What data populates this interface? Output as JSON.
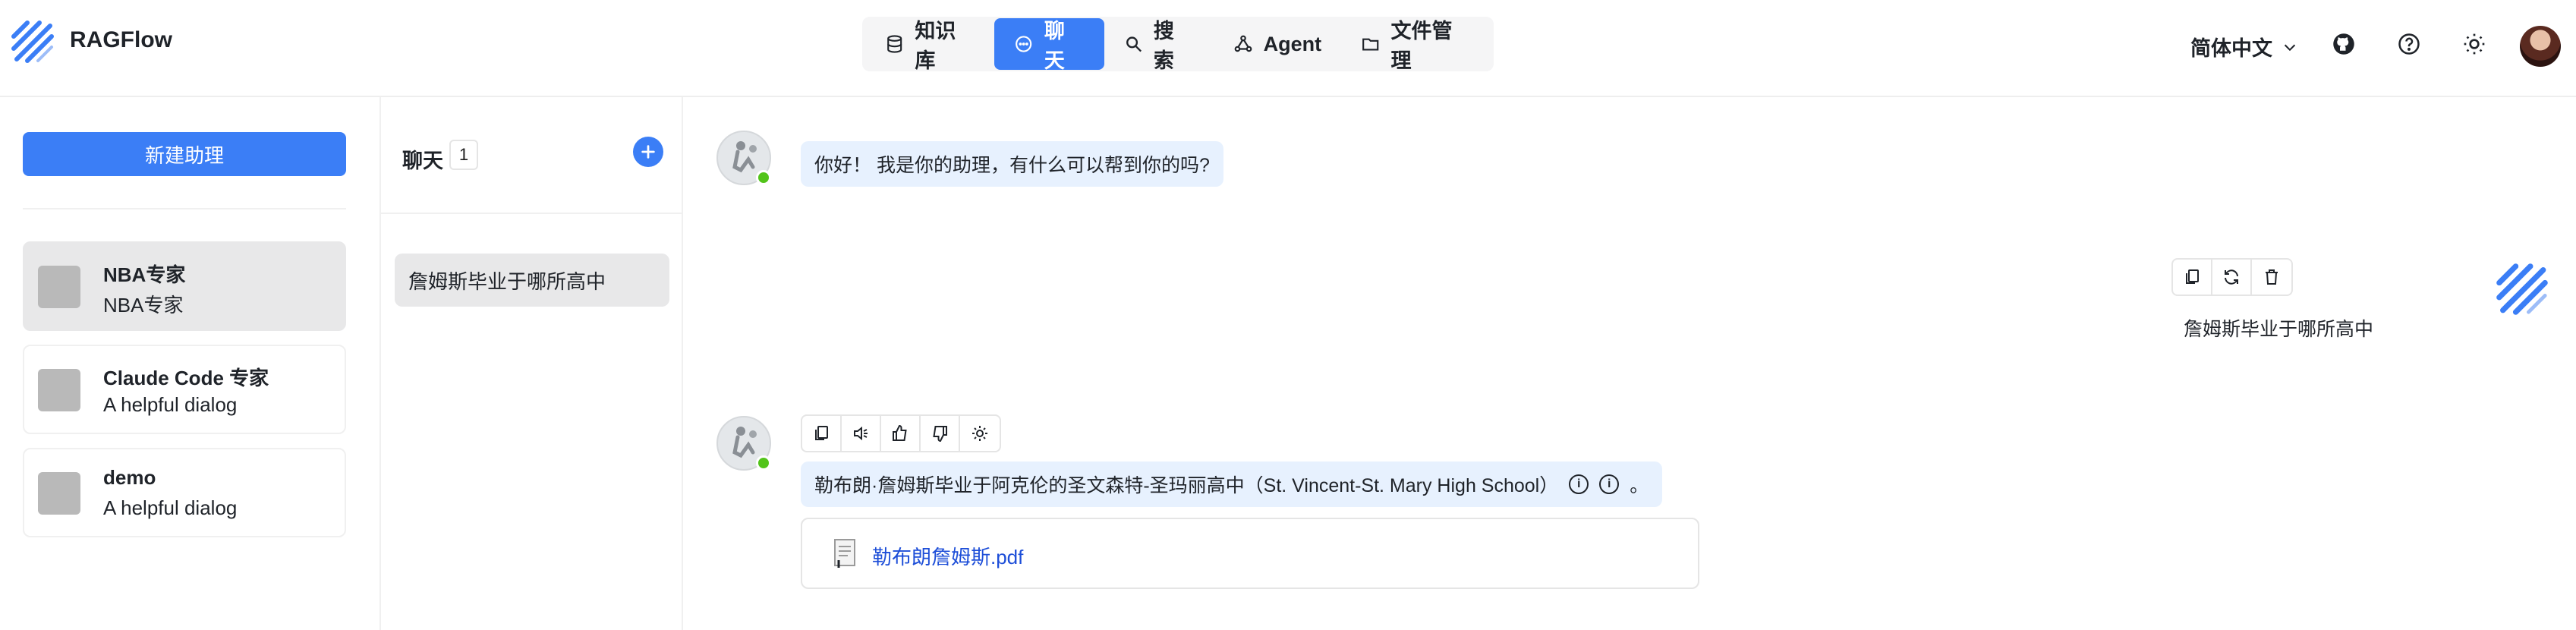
{
  "header": {
    "app_name": "RAGFlow",
    "nav": [
      {
        "label": "知识库",
        "icon": "database-icon",
        "active": false
      },
      {
        "label": "聊天",
        "icon": "chat-icon",
        "active": true
      },
      {
        "label": "搜索",
        "icon": "search-icon",
        "active": false
      },
      {
        "label": "Agent",
        "icon": "agent-icon",
        "active": false
      },
      {
        "label": "文件管理",
        "icon": "folder-icon",
        "active": false
      }
    ],
    "language": "简体中文",
    "icons": [
      "github-icon",
      "help-icon",
      "theme-sun-icon"
    ],
    "accent_color": "#3b7ef6"
  },
  "assistants": {
    "new_button": "新建助理",
    "items": [
      {
        "name": "NBA专家",
        "description": "NBA专家",
        "selected": true
      },
      {
        "name": "Claude Code 专家",
        "description": "A helpful dialog",
        "selected": false
      },
      {
        "name": "demo",
        "description": "A helpful dialog",
        "selected": false
      }
    ]
  },
  "conversations": {
    "title": "聊天",
    "count": "1",
    "items": [
      {
        "title": "詹姆斯毕业于哪所高中",
        "selected": true
      }
    ]
  },
  "chat": {
    "greeting": "你好！ 我是你的助理，有什么可以帮到你的吗?",
    "user_question": "詹姆斯毕业于哪所高中",
    "user_tools": [
      "copy-icon",
      "regenerate-icon",
      "delete-icon"
    ],
    "answer_tools": [
      "copy-icon",
      "speaker-icon",
      "thumbs-up-icon",
      "thumbs-down-icon",
      "bulb-icon"
    ],
    "answer_text": "勒布朗·詹姆斯毕业于阿克伦的圣文森特-圣玛丽高中（St. Vincent-St. Mary High School）",
    "answer_cite_1": "i",
    "answer_cite_2": "i",
    "answer_end": "。",
    "reference_doc": "勒布朗詹姆斯.pdf"
  }
}
